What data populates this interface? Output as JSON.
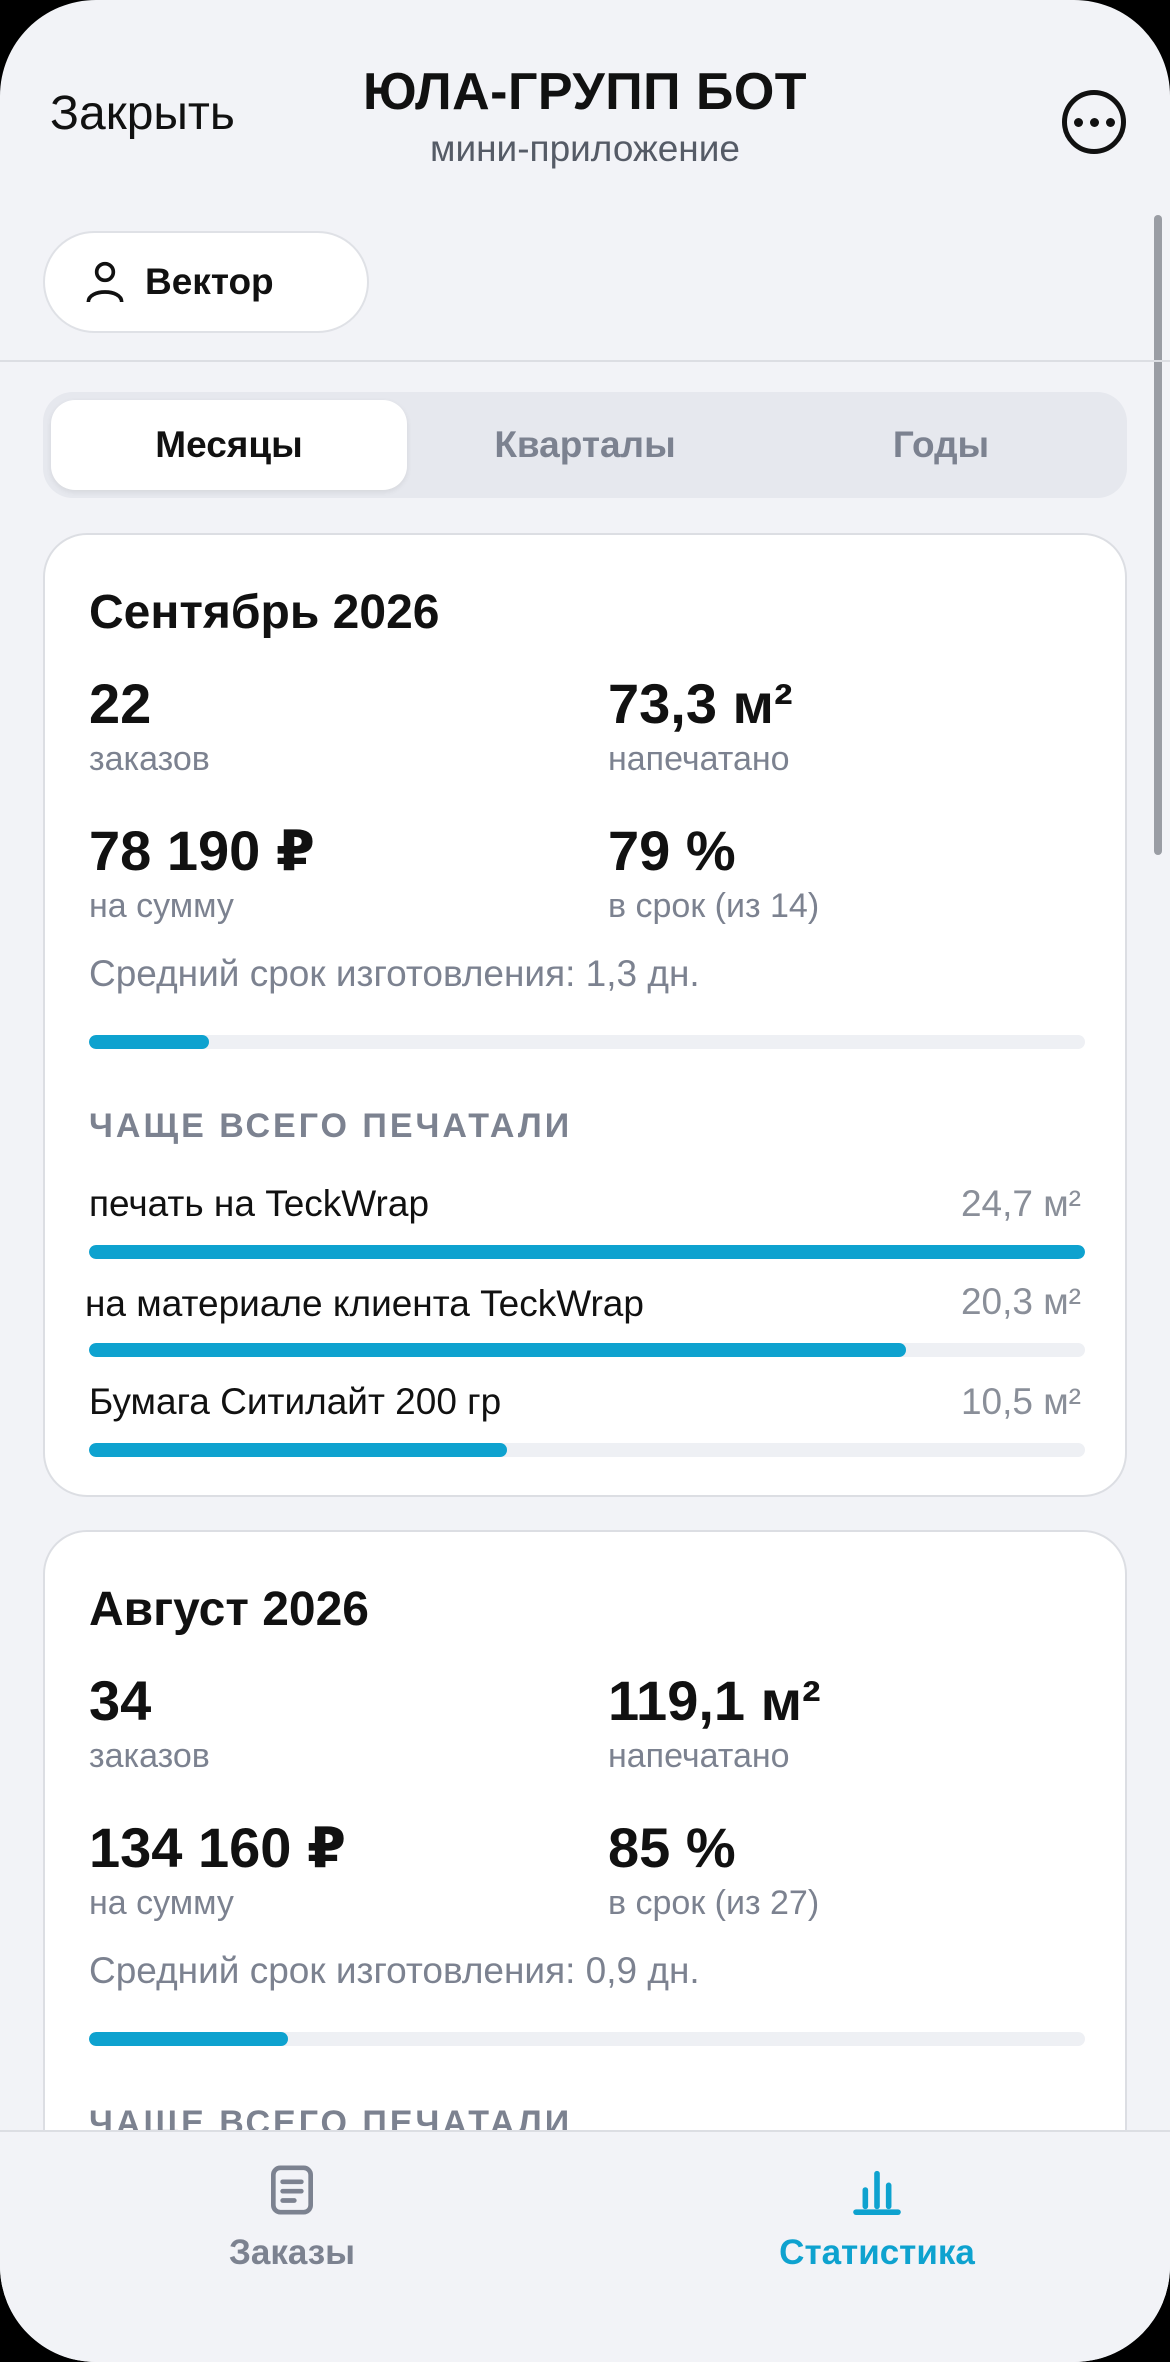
{
  "header": {
    "close_label": "Закрыть",
    "title": "ЮЛА-ГРУПП БОТ",
    "subtitle": "мини-приложение"
  },
  "user": {
    "name": "Вектор"
  },
  "period_tabs": [
    {
      "label": "Месяцы",
      "active": true
    },
    {
      "label": "Кварталы",
      "active": false
    },
    {
      "label": "Годы",
      "active": false
    }
  ],
  "months": [
    {
      "title": "Сентябрь 2026",
      "orders_value": "22",
      "orders_label": "заказов",
      "printed_value": "73,3 м²",
      "printed_label": "напечатано",
      "sum_value": "78 190 ₽",
      "sum_label": "на сумму",
      "ontime_value": "79 %",
      "ontime_label": "в срок (из 14)",
      "avg_text": "Средний срок изготовления: 1,3 дн.",
      "avg_progress": 0.12,
      "top_heading": "ЧАЩЕ ВСЕГО ПЕЧАТАЛИ",
      "materials": [
        {
          "name": "печать на TeckWrap",
          "value": "24,7 м²",
          "progress": 1.0
        },
        {
          "name": "на материале клиента TeckWrap",
          "value": "20,3 м²",
          "progress": 0.82
        },
        {
          "name": "Бумага Ситилайт 200 гр",
          "value": "10,5 м²",
          "progress": 0.42
        }
      ]
    },
    {
      "title": "Август 2026",
      "orders_value": "34",
      "orders_label": "заказов",
      "printed_value": "119,1 м²",
      "printed_label": "напечатано",
      "sum_value": "134 160 ₽",
      "sum_label": "на сумму",
      "ontime_value": "85 %",
      "ontime_label": "в срок (из 27)",
      "avg_text": "Средний срок изготовления: 0,9 дн.",
      "avg_progress": 0.2,
      "top_heading": "ЧАЩЕ ВСЕГО ПЕЧАТАЛИ"
    }
  ],
  "tabbar": {
    "orders_label": "Заказы",
    "stats_label": "Статистика",
    "accent": "#0ea2cf"
  }
}
